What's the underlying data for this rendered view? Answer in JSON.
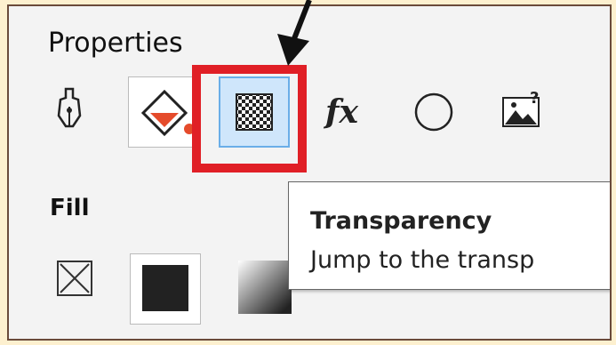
{
  "panel": {
    "title": "Properties"
  },
  "toolbar": {
    "tools": [
      {
        "icon": "pen-nib-icon"
      },
      {
        "icon": "fill-bucket-icon"
      },
      {
        "icon": "transparency-checker-icon",
        "active": true
      },
      {
        "icon": "fx-icon",
        "label": "fx"
      },
      {
        "icon": "circle-icon"
      },
      {
        "icon": "image-question-icon"
      }
    ]
  },
  "fill": {
    "label": "Fill"
  },
  "tooltip": {
    "title": "Transparency",
    "description": "Jump to the transp"
  },
  "colors": {
    "highlight": "#e01f26",
    "active_bg": "#cfe6fb",
    "background": "#fdf0cf"
  }
}
